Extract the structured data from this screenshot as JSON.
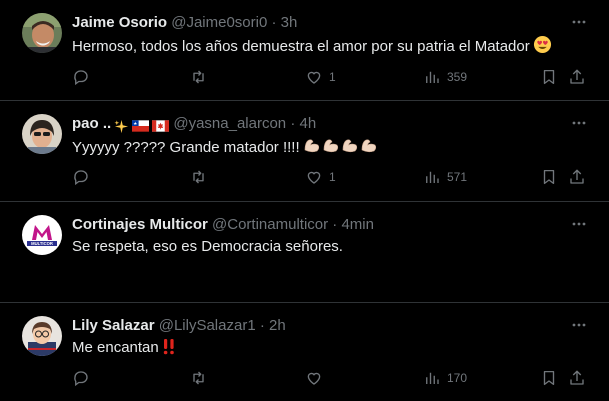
{
  "tweets": [
    {
      "name": "Jaime Osorio",
      "handle": "@Jaime0sori0",
      "separator": "·",
      "time": "3h",
      "text": "Hermoso, todos los años demuestra el amor por su patria el Matador",
      "text_emoji": "smiling-face-with-heart-eyes",
      "likes": "1",
      "views": "359"
    },
    {
      "name": "pao ..",
      "name_icons": [
        "sparkles-icon",
        "chile-flag-icon",
        "canada-flag-icon"
      ],
      "handle": "@yasna_alarcon",
      "separator": "·",
      "time": "4h",
      "text": "Yyyyyy ????? Grande matador !!!!",
      "text_emoji": "flexed-biceps x4",
      "likes": "1",
      "views": "571"
    },
    {
      "name": "Cortinajes Multicor",
      "handle": "@Cortinamulticor",
      "separator": "·",
      "time": "4min",
      "text": "Se respeta, eso es Democracia señores.",
      "avatar_text": "MULTICOR"
    },
    {
      "name": "Lily Salazar",
      "handle": "@LilySalazar1",
      "separator": "·",
      "time": "2h",
      "text": "Me encantan",
      "text_emoji": "double-exclamation-mark",
      "views": "170"
    }
  ],
  "colors": {
    "background": "#000000",
    "text": "#e7e9ea",
    "muted": "#71767b",
    "divider": "#2f3336"
  }
}
